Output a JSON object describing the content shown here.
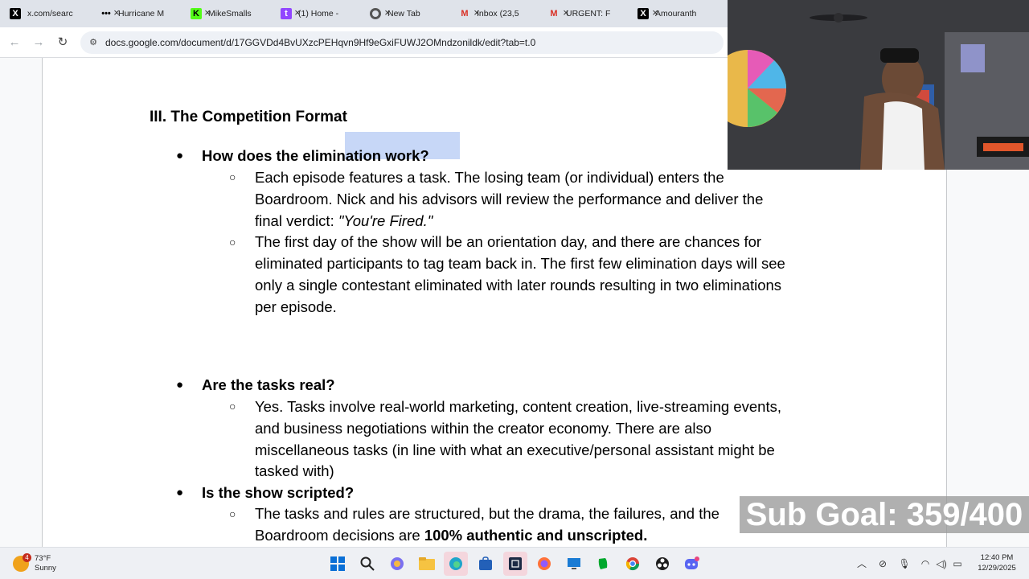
{
  "browser": {
    "tabs": [
      {
        "label": "x.com/searc",
        "icon": "x-icon"
      },
      {
        "label": "Hurricane M",
        "icon": "dots-icon"
      },
      {
        "label": "MikeSmalls",
        "icon": "kick-icon"
      },
      {
        "label": "(1) Home -",
        "icon": "twitch-icon"
      },
      {
        "label": "New Tab",
        "icon": "chrome-icon"
      },
      {
        "label": "Inbox (23,5",
        "icon": "gmail-icon"
      },
      {
        "label": "URGENT: F",
        "icon": "gmail-icon"
      },
      {
        "label": "Amouranth",
        "icon": "x-icon"
      }
    ],
    "url": "docs.google.com/document/d/17GGVDd4BvUXzcPEHqvn9Hf9eGxiFUWJ2OMndzonildk/edit?tab=t.0"
  },
  "document": {
    "heading": "III. The Competition Format",
    "q1": "How does the elimination work?",
    "q1_a1_l1": "Each episode features a task. The losing team (or individual) enters the",
    "q1_a1_l2": "Boardroom. Nick and his advisors will review the performance and deliver the",
    "q1_a1_l3a": "final verdict: ",
    "q1_a1_l3b": "\"You're Fired.\"",
    "q1_a2_l1": "The first day of the show will be an orientation day, and there are chances for",
    "q1_a2_l2": "eliminated participants to tag team back in.  The first few elimination days will see",
    "q1_a2_l3": "only a single contestant eliminated with later rounds resulting in two eliminations",
    "q1_a2_l4": "per episode.",
    "q2": "Are the tasks real?",
    "q2_a1_l1": "Yes. Tasks involve real-world marketing, content creation, live-streaming events,",
    "q2_a1_l2": "and business negotiations within the creator economy.  There are also",
    "q2_a1_l3": "miscellaneous tasks (in line with what an  executive/personal assistant might be",
    "q2_a1_l4": "tasked with)",
    "q3": "Is the show scripted?",
    "q3_a1_l1": "The tasks and rules are structured, but the drama, the failures, and the",
    "q3_a1_l2a": "Boardroom decisions are ",
    "q3_a1_l2b": "100% authentic and unscripted.",
    "bullet_glyph": "●",
    "subbullet_glyph": "○"
  },
  "overlay": {
    "sub_goal": "Sub Goal: 359/400"
  },
  "taskbar": {
    "weather_temp": "73°F",
    "weather_desc": "Sunny",
    "weather_badge": "4",
    "time": "12:40 PM",
    "date": "12/29/2025",
    "apps": [
      "windows-start",
      "search",
      "copilot",
      "file-explorer",
      "edge",
      "store",
      "terminal",
      "firefox",
      "remote",
      "evernote",
      "chrome",
      "obs",
      "discord"
    ]
  },
  "colors": {
    "selection": "#c7d7f7",
    "tabbar": "#dfe3ea",
    "accent": "#1a73e8"
  }
}
